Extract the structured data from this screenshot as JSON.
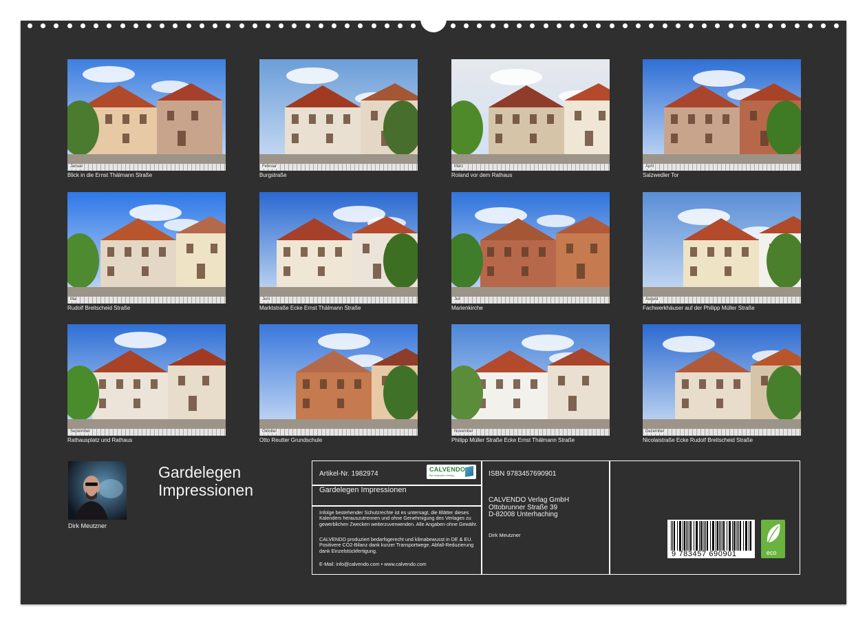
{
  "photos": [
    {
      "caption": "Blick in die Ernst Thälmann Straße",
      "month": "Januar"
    },
    {
      "caption": "Burgstraße",
      "month": "Februar"
    },
    {
      "caption": "Roland vor dem Rathaus",
      "month": "März"
    },
    {
      "caption": "Salzwedler Tor",
      "month": "April"
    },
    {
      "caption": "Rudolf Breitscheid Straße",
      "month": "Mai"
    },
    {
      "caption": "Marktstraße Ecke Ernst Thälmann Straße",
      "month": "Juni"
    },
    {
      "caption": "Marienkirche",
      "month": "Juli"
    },
    {
      "caption": "Fachwerkhäuser auf der  Philipp Müller Straße",
      "month": "August"
    },
    {
      "caption": "Rathausplatz und Rathaus",
      "month": "September"
    },
    {
      "caption": "Otto Reutter Grundschule",
      "month": "Oktober"
    },
    {
      "caption": "Philipp Müller Straße Ecke Ernst Thälmann Straße",
      "month": "November"
    },
    {
      "caption": "Nicolaistraße Ecke Rudolf Breitscheid Straße",
      "month": "Dezember"
    }
  ],
  "author": {
    "name": "Dirk Meutzner"
  },
  "title": {
    "line1": "Gardelegen",
    "line2": "Impressionen"
  },
  "info": {
    "article_no": "Artikel-Nr. 1982974",
    "product_title": "Gardelegen Impressionen",
    "legal_text": "Infolge bestehender Schutzrechte ist es untersagt, die Blätter dieses Kalenders herauszutrennen und ohne Genehmigung des Verlages zu gewerblichen Zwecken weiterzuverwenden. Alle Angaben ohne Gewähr.",
    "eco_text": "CALVENDO produziert bedarfsgerecht und klimabewusst in DE & EU. Positivere CO2-Bilanz dank kurzer Transportwege. Abfall-Reduzierung dank Einzelstückfertigung.",
    "contact": "E-Mail: info@calvendo.com • www.calvendo.com",
    "isbn": "ISBN 9783457690901",
    "publisher_name": "CALVENDO Verlag GmbH",
    "publisher_street": "Ottobrunner Straße 39",
    "publisher_city": "D-82008 Unterhaching",
    "photographer": "Dirk Meutzner",
    "logo_brand": "CALVENDO",
    "logo_sub": "Bei Kalender-Verlag",
    "barcode_digits": "9 783457 690901",
    "eco_label": "eco"
  },
  "colors": {
    "background": "#2f2f2f",
    "text": "#f2f2f2",
    "sky": "#2f6fd6",
    "eco_green": "#6ab33f"
  }
}
